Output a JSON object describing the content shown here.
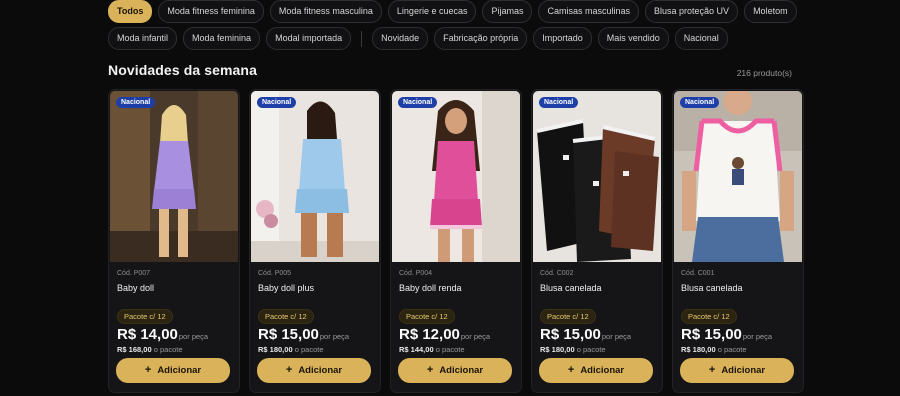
{
  "filters_row1": [
    "Todos",
    "Moda fitness feminina",
    "Moda fitness masculina",
    "Lingerie e cuecas",
    "Pijamas",
    "Camisas masculinas",
    "Blusa proteção UV",
    "Moletom"
  ],
  "filters_row2a": [
    "Moda infantil",
    "Moda feminina",
    "Modal importada"
  ],
  "filters_row2b": [
    "Novidade",
    "Fabricação própria",
    "Importado",
    "Mais vendido",
    "Nacional"
  ],
  "section": {
    "title": "Novidades da semana",
    "count": "216 produto(s)"
  },
  "add_label": "Adicionar",
  "products": [
    {
      "badge": "Nacional",
      "code": "Cód. P007",
      "name": "Baby doll",
      "pack": "Pacote c/ 12",
      "price": "R$ 14,00",
      "per": "por peça",
      "total": "R$ 168,00",
      "total_suffix": "o pacote"
    },
    {
      "badge": "Nacional",
      "code": "Cód. P005",
      "name": "Baby doll plus",
      "pack": "Pacote c/ 12",
      "price": "R$ 15,00",
      "per": "por peça",
      "total": "R$ 180,00",
      "total_suffix": "o pacote"
    },
    {
      "badge": "Nacional",
      "code": "Cód. P004",
      "name": "Baby doll renda",
      "pack": "Pacote c/ 12",
      "price": "R$ 12,00",
      "per": "por peça",
      "total": "R$ 144,00",
      "total_suffix": "o pacote"
    },
    {
      "badge": "Nacional",
      "code": "Cód. C002",
      "name": "Blusa canelada",
      "pack": "Pacote c/ 12",
      "price": "R$ 15,00",
      "per": "por peça",
      "total": "R$ 180,00",
      "total_suffix": "o pacote"
    },
    {
      "badge": "Nacional",
      "code": "Cód. C001",
      "name": "Blusa canelada",
      "pack": "Pacote c/ 12",
      "price": "R$ 15,00",
      "per": "por peça",
      "total": "R$ 180,00",
      "total_suffix": "o pacote"
    }
  ]
}
